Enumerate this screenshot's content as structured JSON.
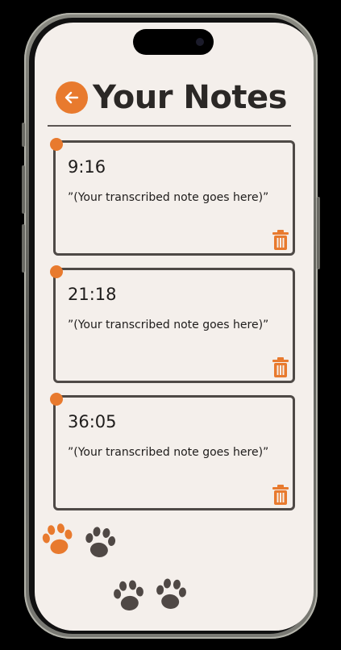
{
  "header": {
    "title": "Your Notes",
    "back_icon": "arrow-left-icon"
  },
  "notes": [
    {
      "time": "9:16",
      "text": "”(Your transcribed note goes here)”"
    },
    {
      "time": "21:18",
      "text": "”(Your transcribed note goes here)”"
    },
    {
      "time": "36:05",
      "text": "”(Your transcribed note goes here)”"
    }
  ],
  "colors": {
    "accent": "#e87a2e",
    "background": "#f4efeb",
    "text": "#2b2826",
    "border": "#4e4946",
    "paw_dark": "#4f4845"
  },
  "icons": {
    "delete": "trash-icon",
    "decoration": "paw-print-icon"
  }
}
